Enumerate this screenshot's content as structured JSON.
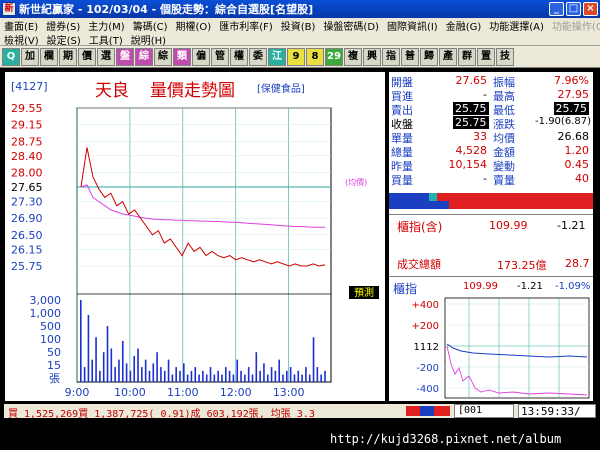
{
  "window": {
    "title": "新世紀贏家 - 102/03/04 - 個股走勢：綜合自選股[名望股]",
    "min": "_",
    "max": "□",
    "close": "×"
  },
  "menu": {
    "row1": [
      "畫面(E)",
      "證券(S)",
      "主力(M)",
      "籌碼(C)",
      "期權(O)",
      "匯市利率(F)",
      "投資(B)",
      "操盤密碼(D)",
      "國際資訊(I)",
      "金融(G)",
      "功能選擇(A)",
      "功能操作(O)"
    ],
    "row2": [
      "檢視(V)",
      "設定(S)",
      "工具(T)",
      "說明(H)"
    ]
  },
  "toolbar": [
    "Q",
    "加",
    "欄",
    "期",
    "價",
    "選",
    "盤",
    "綜",
    "綜",
    "類",
    "偏",
    "管",
    "權",
    "委",
    "江",
    "9",
    "8",
    "29",
    "複",
    "興",
    "指",
    "普",
    "歸",
    "產",
    "群",
    "置",
    "技"
  ],
  "stock": {
    "code": "[4127]",
    "name": "天良",
    "title": "量價走勢圖",
    "category": "[保健食品]"
  },
  "chart_data": {
    "type": "line",
    "x_ticks": [
      "9:00",
      "10:00",
      "11:00",
      "12:00",
      "13:00"
    ],
    "price_ticks": [
      "29.55",
      "29.15",
      "28.75",
      "28.40",
      "28.00",
      "27.65",
      "27.30",
      "26.90",
      "26.50",
      "26.15",
      "25.75"
    ],
    "vol_ticks": [
      "3,000",
      "1,000",
      "500",
      "100",
      "50",
      "15",
      "張"
    ],
    "ylim": [
      25.75,
      29.55
    ],
    "ref_price": 27.65,
    "avg_label": "(均價)",
    "price": [
      27.65,
      28.6,
      27.9,
      27.6,
      27.4,
      27.5,
      27.2,
      27.3,
      27.0,
      27.1,
      26.9,
      26.7,
      26.5,
      26.6,
      26.3,
      26.4,
      26.2,
      26.0,
      26.3,
      26.1,
      26.2,
      26.0,
      26.1,
      26.0,
      25.95,
      26.0,
      25.9,
      25.95,
      25.9,
      25.85,
      25.9,
      25.85,
      25.8,
      25.85,
      25.8,
      25.75,
      25.8,
      25.75,
      25.75,
      25.8,
      25.75,
      25.78
    ],
    "avg": [
      27.65,
      27.7,
      27.4,
      27.3,
      27.2,
      27.1,
      27.05,
      27.0,
      26.98,
      26.95,
      26.92,
      26.9,
      26.88,
      26.87,
      26.86,
      26.86,
      26.85,
      26.85,
      26.84,
      26.84,
      26.83,
      26.83,
      26.82,
      26.82,
      26.81,
      26.8,
      26.8,
      26.79,
      26.78,
      26.77,
      26.76,
      26.75,
      26.74,
      26.73,
      26.72,
      26.71,
      26.7,
      26.7,
      26.69,
      26.68,
      26.68,
      26.68
    ],
    "volume": [
      220,
      40,
      180,
      60,
      120,
      30,
      80,
      150,
      90,
      40,
      60,
      110,
      50,
      30,
      70,
      90,
      40,
      60,
      30,
      50,
      80,
      40,
      30,
      60,
      20,
      40,
      30,
      50,
      20,
      30,
      40,
      20,
      30,
      20,
      40,
      20,
      30,
      20,
      40,
      30,
      20,
      60,
      30,
      20,
      40,
      20,
      80,
      30,
      50,
      20,
      40,
      30,
      60,
      20,
      30,
      40,
      20,
      30,
      20,
      40,
      20,
      120,
      40,
      20,
      30
    ]
  },
  "quote": {
    "open_l": "開盤",
    "open": "27.65",
    "amp_l": "振幅",
    "amp": "7.96%",
    "bid_l": "買進",
    "bid": "-",
    "high_l": "最高",
    "high": "27.95",
    "ask_l": "賣出",
    "ask": "25.75",
    "low_l": "最低",
    "low": "25.75",
    "close_l": "收盤",
    "close": "25.75",
    "chg_l": "漲跌",
    "chg": "-1.90(6.87)",
    "unit_l": "單量",
    "unit": "33",
    "avgp_l": "均價",
    "avgp": "26.68",
    "tot_l": "總量",
    "tot": "4,528",
    "amt_l": "金額",
    "amt": "1.20",
    "yv_l": "昨量",
    "yv": "10,154",
    "var_l": "變動",
    "var": "0.45",
    "bv_l": "買量",
    "bv": "-",
    "sv_l": "賣量",
    "sv": "40"
  },
  "index": {
    "label": "櫃指(含)",
    "value": "109.99",
    "chg": "-1.21",
    "vol_label": "成交總額",
    "vol": "173.25億",
    "vol_chg": "28.7",
    "mini_label": "櫃指",
    "mini_value": "109.99",
    "mini_chg": "-1.21",
    "mini_pct": "-1.09%",
    "mini_ticks": [
      "+400",
      "+200",
      "1112",
      "-200",
      "-400"
    ]
  },
  "predict": "預測",
  "status": {
    "trade": "買 1,525,269買 1,387,725( 0.91)成 603,192張, 均張 3.3",
    "code": "[001",
    "clock": "13:59:33/"
  },
  "watermark": "http://kujd3268.pixnet.net/album",
  "colors": {
    "price": "#d00000",
    "avg": "#e040e0",
    "volume": "#1a2fd0",
    "grid": "#2aa8a0"
  }
}
